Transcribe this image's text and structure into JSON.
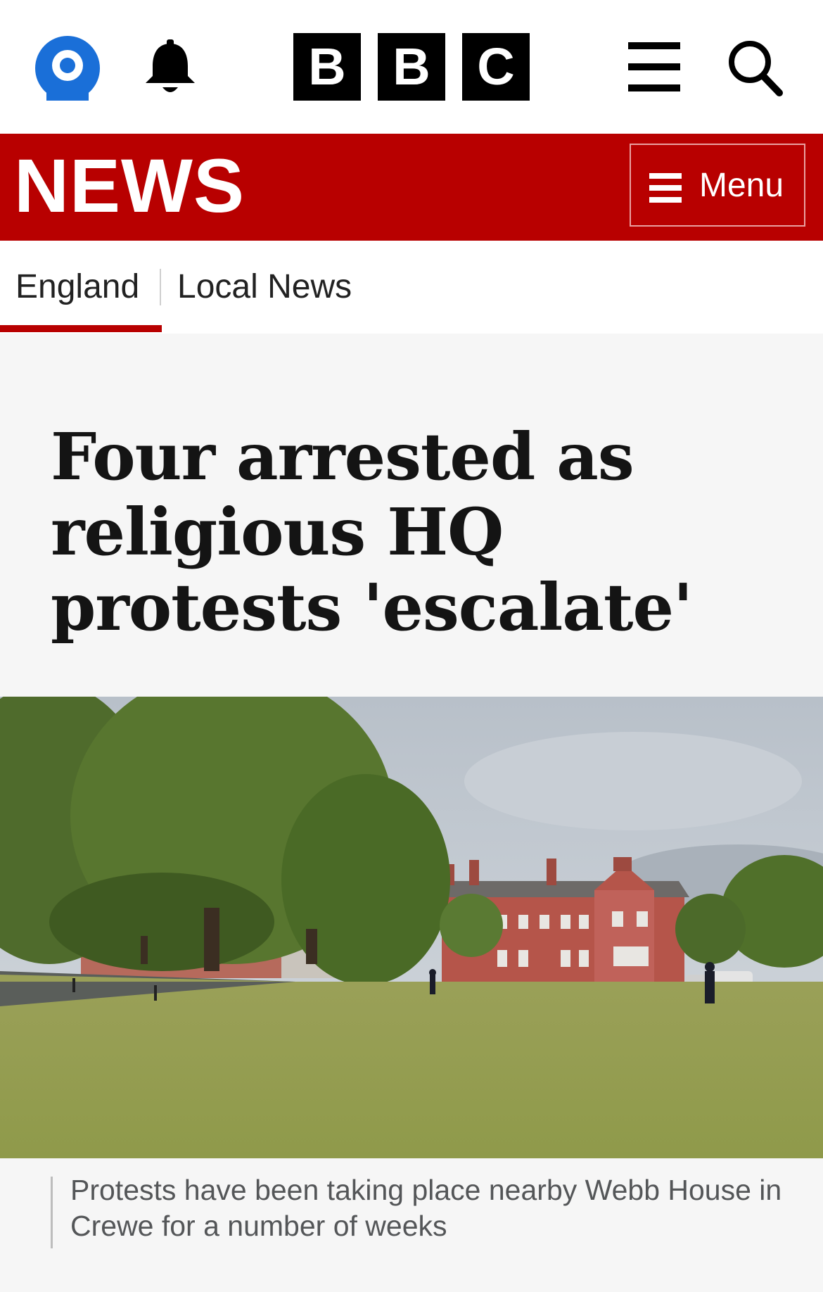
{
  "header": {
    "logo_letters": [
      "B",
      "B",
      "C"
    ],
    "icons": {
      "account": "account-icon",
      "notifications": "bell-icon",
      "menu": "hamburger-icon",
      "search": "search-icon"
    },
    "account_color": "#1a6fd8"
  },
  "news_bar": {
    "title": "NEWS",
    "menu_label": "Menu",
    "background_color": "#b80000"
  },
  "subnav": {
    "items": [
      {
        "label": "England",
        "active": true
      },
      {
        "label": "Local News",
        "active": false
      }
    ]
  },
  "article": {
    "headline": "Four arrested as religious HQ protests 'escalate'",
    "image_caption": "Protests have been taking place nearby Webb House in Crewe for a number of weeks"
  }
}
